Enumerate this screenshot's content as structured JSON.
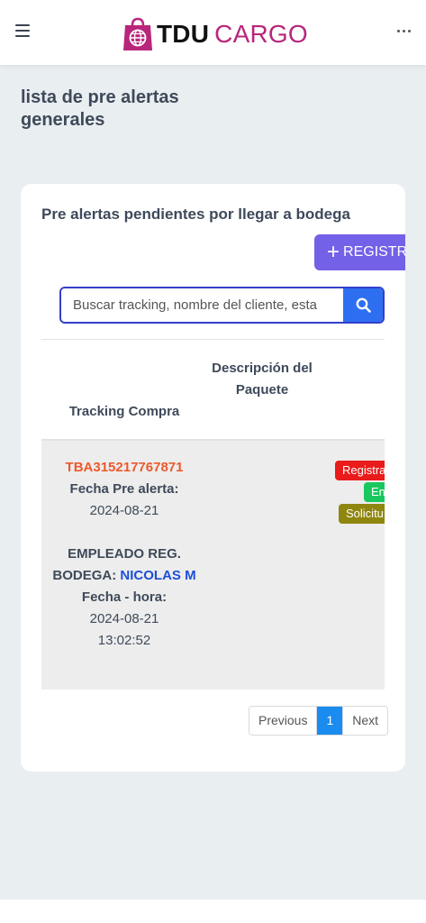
{
  "header": {
    "logo_bold": "TDU",
    "logo_light": "CARGO",
    "menu_icon": "hamburger-menu-icon",
    "more_icon": "more-dots-icon",
    "brand_color": "#b8267b"
  },
  "page": {
    "title": "lista de pre alertas generales"
  },
  "card": {
    "title": "Pre alertas pendientes por llegar a bodega",
    "register_button": "REGISTRA T",
    "search": {
      "placeholder": "Buscar tracking, nombre del cliente, esta",
      "icon": "search-icon"
    }
  },
  "table": {
    "columns": [
      "Tracking Compra",
      "Descripción del Paquete"
    ],
    "rows": [
      {
        "tracking": "TBA315217767871",
        "fecha_label": "Fecha Pre alerta:",
        "fecha": "2024-08-21",
        "empleado_label": "EMPLEADO REG. BODEGA:",
        "empleado": "NICOLAS M",
        "fecha_hora_label": "Fecha - hora:",
        "fecha_hora_date": "2024-08-21",
        "fecha_hora_time": "13:02:52",
        "descripcion": "",
        "badges": [
          {
            "label": "Registra",
            "color": "#ea1b1b"
          },
          {
            "label": "En",
            "color": "#18c85f"
          },
          {
            "label": "Solicitu",
            "color": "#8f8610"
          }
        ]
      }
    ]
  },
  "pagination": {
    "previous": "Previous",
    "current": "1",
    "next": "Next"
  },
  "colors": {
    "primary": "#7361e8",
    "search_button": "#2e6ff2",
    "tracking_code": "#ec5a2c",
    "employee_name": "#1b4fd8"
  }
}
